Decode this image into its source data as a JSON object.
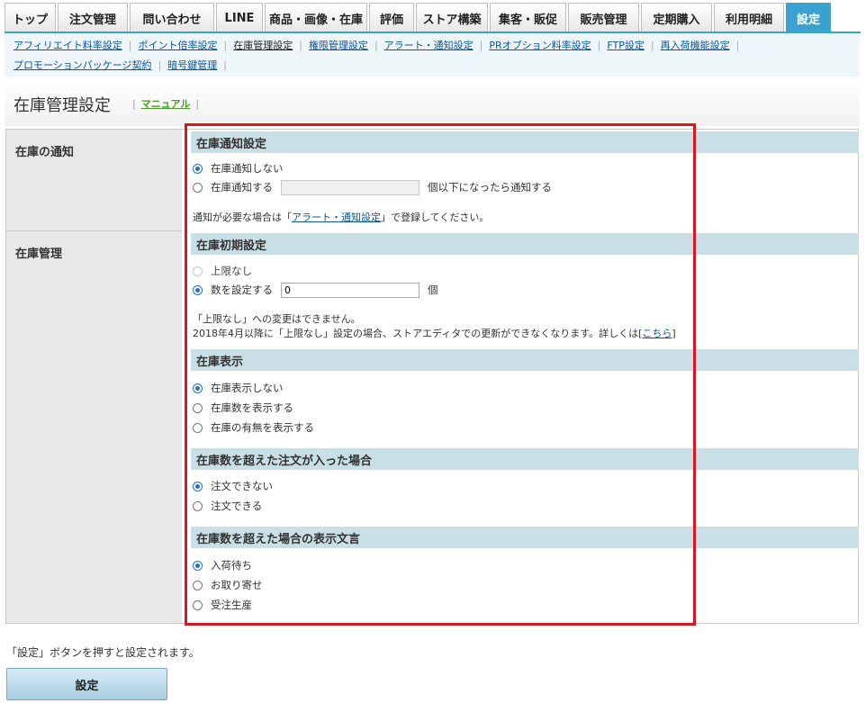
{
  "tabs": [
    "トップ",
    "注文管理",
    "問い合わせ",
    "LINE",
    "商品・画像・在庫",
    "評価",
    "ストア構築",
    "集客・販促",
    "販売管理",
    "定期購入",
    "利用明細",
    "設定"
  ],
  "subnav": {
    "row1": [
      "アフィリエイト料率設定",
      "ポイント倍率設定",
      "在庫管理設定",
      "権限管理設定",
      "アラート・通知設定",
      "PRオプション料率設定",
      "FTP設定",
      "再入荷機能設定"
    ],
    "row2": [
      "プロモーションパッケージ契約",
      "暗号鍵管理"
    ]
  },
  "page": {
    "title": "在庫管理設定",
    "manual_link": "マニュアル"
  },
  "form": {
    "row1_label": "在庫の通知",
    "row2_label": "在庫管理",
    "notify": {
      "heading": "在庫通知設定",
      "opt_off": "在庫通知しない",
      "opt_on": "在庫通知する",
      "opt_on_suffix": "個以下になったら通知する",
      "threshold_value": "",
      "note_prefix": "通知が必要な場合は「",
      "note_link": "アラート・通知設定",
      "note_suffix": "」で登録してください。"
    },
    "initial": {
      "heading": "在庫初期設定",
      "opt_unlimited": "上限なし",
      "opt_set": "数を設定する",
      "count_value": "0",
      "unit": "個",
      "note1": "「上限なし」への変更はできません。",
      "note2_prefix": "2018年4月以降に「上限なし」設定の場合、ストアエディタでの更新ができなくなります。詳しくは[",
      "note2_link": "こちら",
      "note2_suffix": "]"
    },
    "display": {
      "heading": "在庫表示",
      "options": [
        "在庫表示しない",
        "在庫数を表示する",
        "在庫の有無を表示する"
      ]
    },
    "over_order": {
      "heading": "在庫数を超えた注文が入った場合",
      "options": [
        "注文できない",
        "注文できる"
      ]
    },
    "over_text": {
      "heading": "在庫数を超えた場合の表示文言",
      "options": [
        "入荷待ち",
        "お取り寄せ",
        "受注生産"
      ]
    }
  },
  "footer": {
    "text": "「設定」ボタンを押すと設定されます。",
    "submit_label": "設定"
  }
}
